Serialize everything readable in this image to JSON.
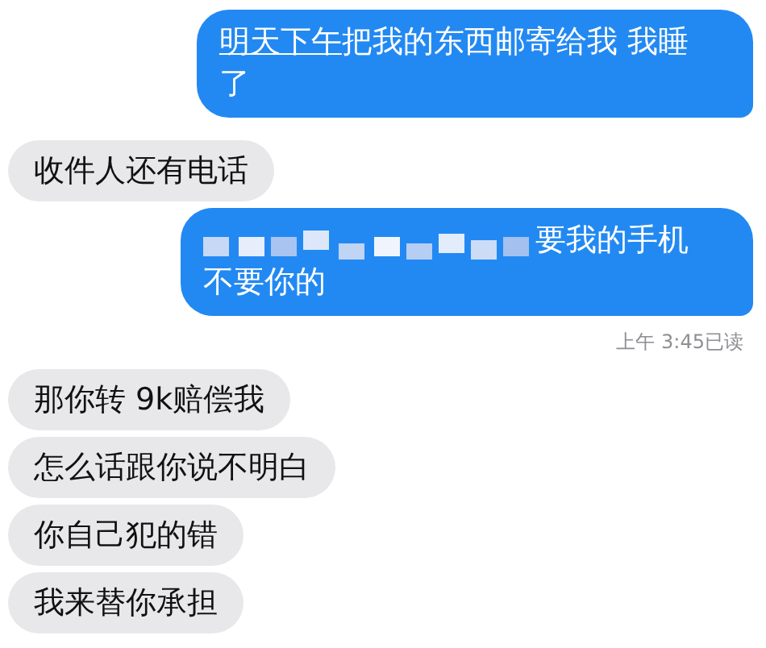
{
  "messages": [
    {
      "kind": "sent",
      "link": "明天下午",
      "redacted": false,
      "lines": [
        "把我的东西邮寄给我 我睡",
        "了"
      ]
    },
    {
      "kind": "received",
      "redacted": false,
      "lines": [
        "收件人还有电话"
      ]
    },
    {
      "kind": "sent",
      "redacted": true,
      "lines": [
        "要我的手机",
        "不要你的"
      ]
    },
    {
      "kind": "receipt",
      "lines": [
        "上午 3:45已读"
      ]
    },
    {
      "kind": "received",
      "redacted": false,
      "lines": [
        "那你转 9k赔偿我"
      ]
    },
    {
      "kind": "received",
      "redacted": false,
      "lines": [
        "怎么话跟你说不明白"
      ]
    },
    {
      "kind": "received",
      "redacted": false,
      "lines": [
        "你自己犯的错"
      ]
    },
    {
      "kind": "received",
      "redacted": false,
      "lines": [
        "我来替你承担"
      ]
    }
  ]
}
